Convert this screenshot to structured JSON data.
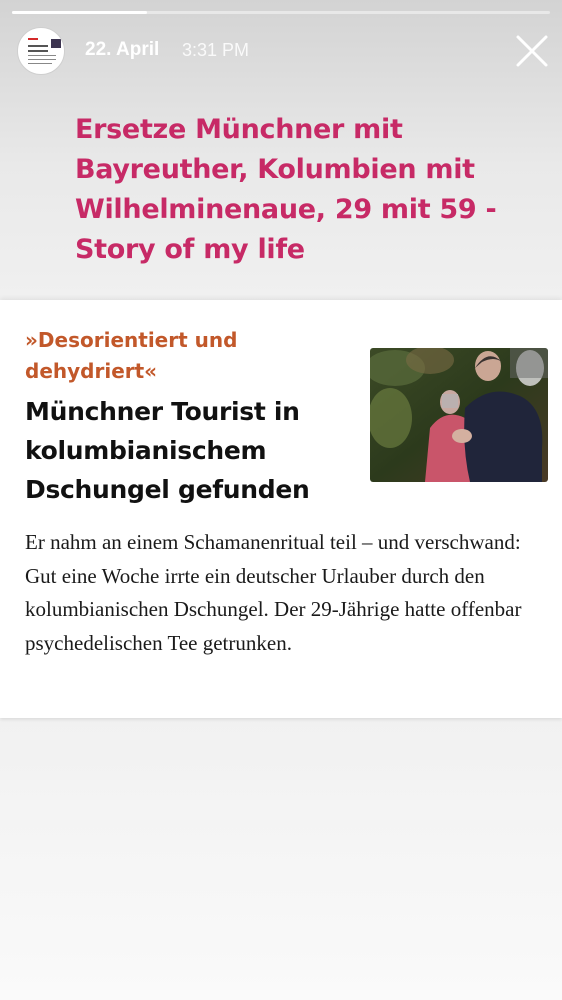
{
  "story": {
    "progress": 0.25,
    "date": "22. April",
    "time": "3:31 PM",
    "caption": "Ersetze Münchner mit Bayreuther, Kolumbien mit Wilhelminenaue, 29 mit 59 - Story of my life"
  },
  "article": {
    "kicker": "»Desorientiert und dehydriert«",
    "headline": "Münchner Tourist in kolumbianischem Dschungel gefunden",
    "body": "Er nahm an einem Schamanenritual teil – und verschwand: Gut eine Woche irrte ein deutscher Urlauber durch den kolumbianischen Dschungel. Der 29-Jährige hatte offenbar psychedelischen Tee getrunken."
  },
  "icons": {
    "close": "close-icon",
    "avatar": "avatar"
  },
  "colors": {
    "caption": "#c72a66",
    "kicker": "#c2582a",
    "headline": "#111111",
    "body": "#1a1a1a",
    "accent_white": "#ffffff"
  }
}
